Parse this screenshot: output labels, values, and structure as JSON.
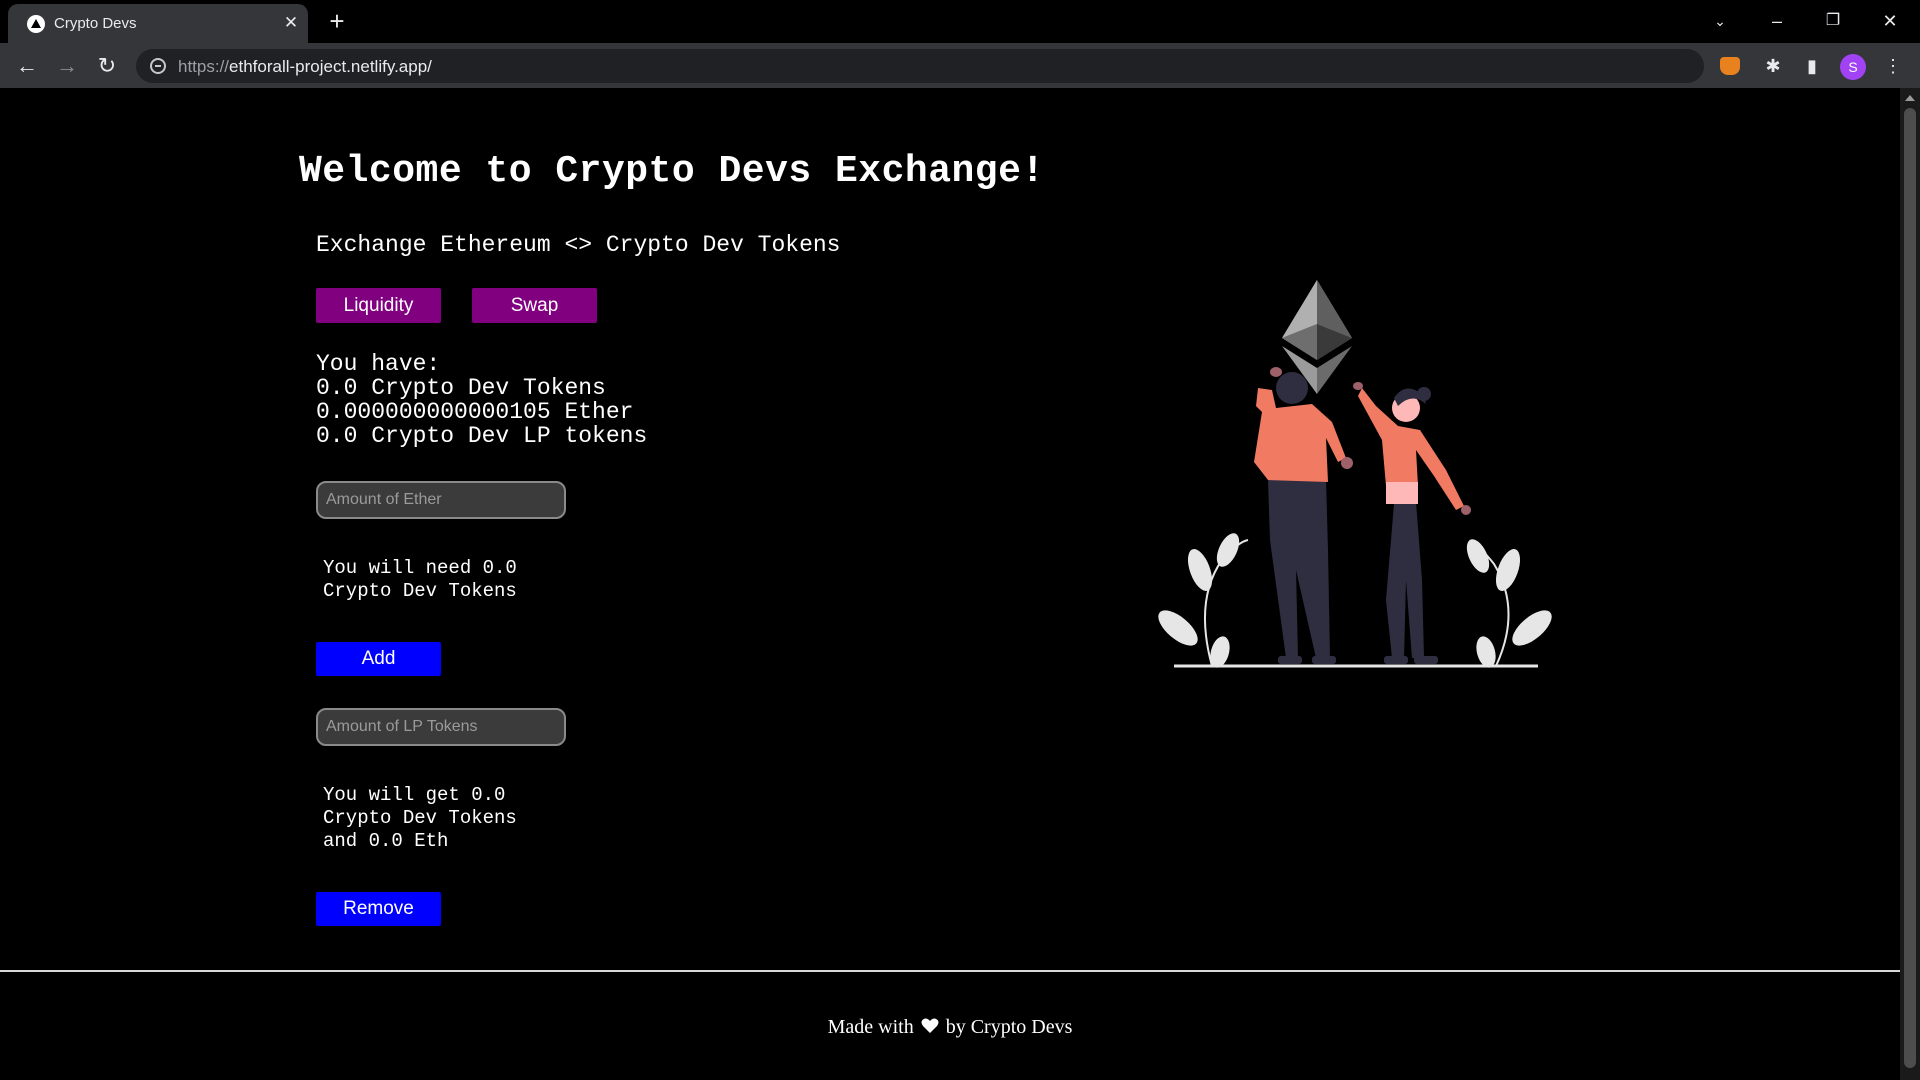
{
  "browser": {
    "tab_title": "Crypto Devs",
    "url_scheme": "https://",
    "url_host": "ethforall-project.netlify.app/",
    "profile_initial": "S"
  },
  "page": {
    "title": "Welcome to Crypto Devs Exchange!",
    "subtitle": "Exchange Ethereum <> Crypto Dev Tokens",
    "tabs": {
      "liquidity_label": "Liquidity",
      "swap_label": "Swap"
    },
    "balance": {
      "heading": "You have:",
      "crypto_dev_tokens": "0.0 Crypto Dev Tokens",
      "ether": "0.000000000000105 Ether",
      "lp_tokens": "0.0 Crypto Dev LP tokens"
    },
    "add_liquidity": {
      "ether_placeholder": "Amount of Ether",
      "need_line1": "You will need 0.0",
      "need_line2": "Crypto Dev Tokens",
      "add_label": "Add"
    },
    "remove_liquidity": {
      "lp_placeholder": "Amount of LP Tokens",
      "get_line1": "You will get 0.0",
      "get_line2": "Crypto Dev Tokens",
      "get_line3": "and 0.0 Eth",
      "remove_label": "Remove"
    },
    "footer": {
      "prefix": "Made with",
      "suffix": "by Crypto Devs"
    }
  },
  "colors": {
    "background": "#000000",
    "tab_button": "#800080",
    "action_button": "#0000ff",
    "figure_shirt": "#f07a62",
    "figure_pants": "#2f2e41"
  }
}
